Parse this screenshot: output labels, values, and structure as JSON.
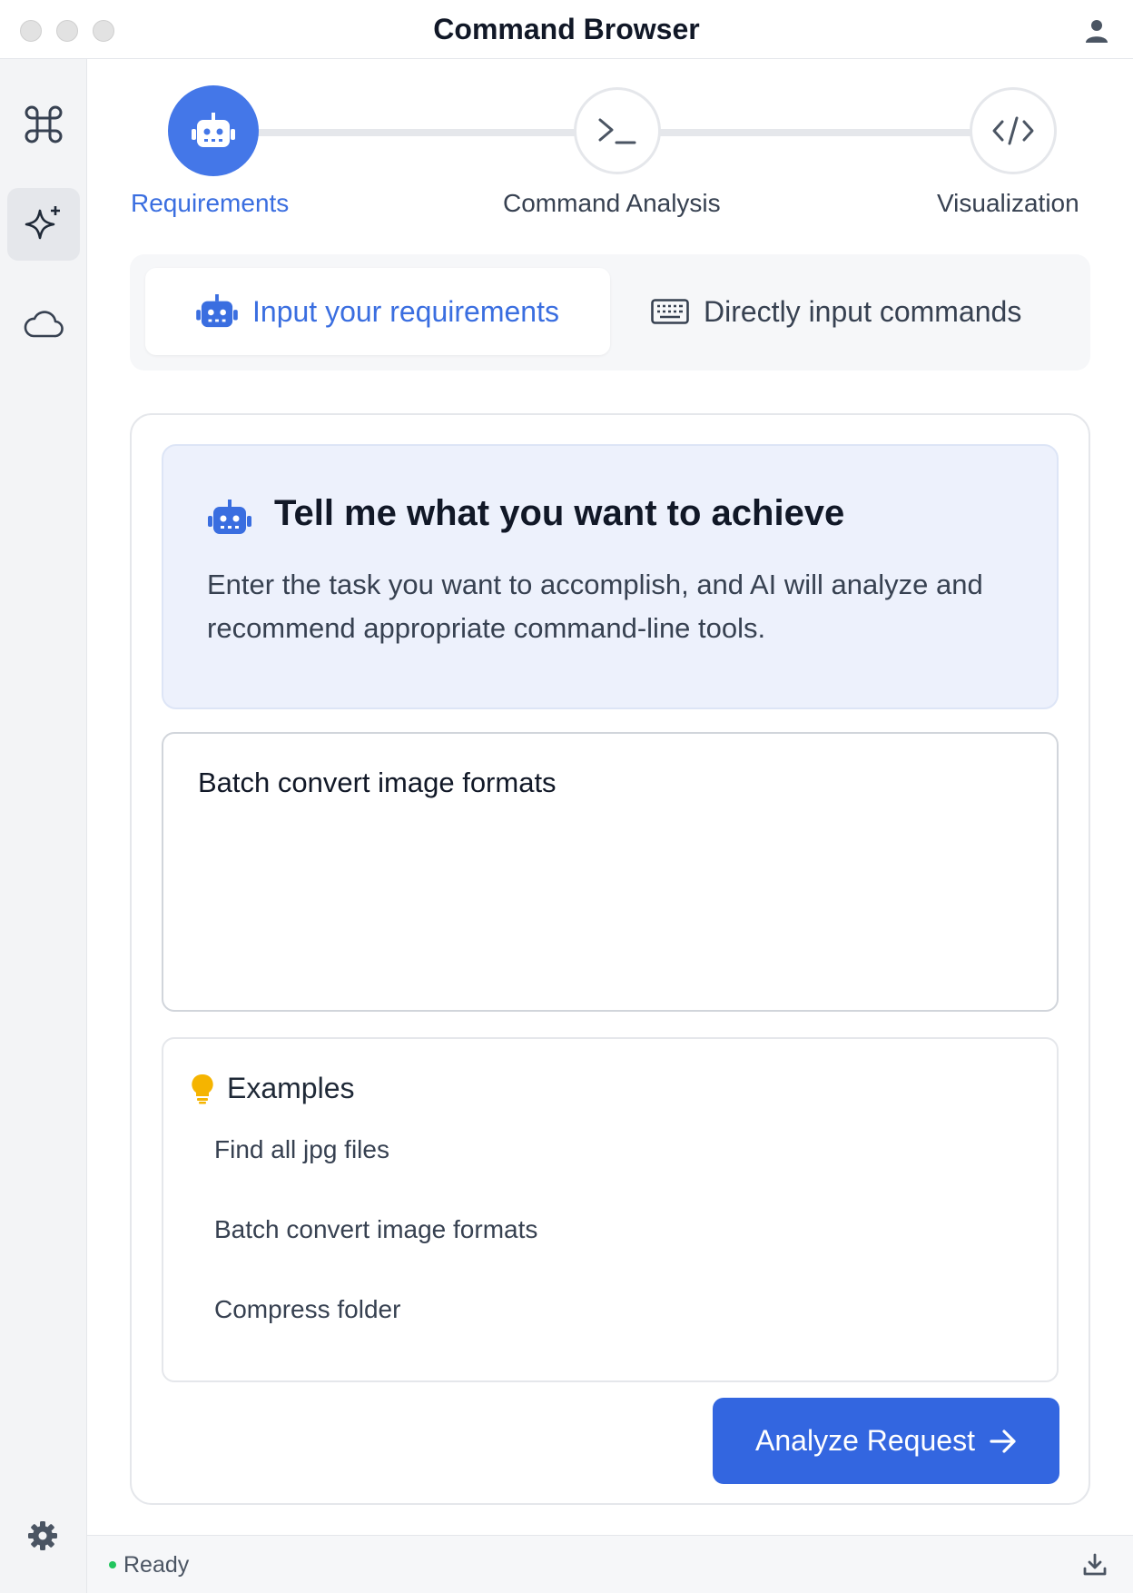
{
  "window": {
    "title": "Command Browser"
  },
  "sidebar": {
    "items": [
      {
        "icon": "command-icon"
      },
      {
        "icon": "sparkles-icon",
        "active": true
      },
      {
        "icon": "cloud-icon"
      }
    ],
    "settings_icon": "gear-icon"
  },
  "stepper": {
    "steps": [
      {
        "label": "Requirements",
        "icon": "robot-icon",
        "active": true
      },
      {
        "label": "Command Analysis",
        "icon": "terminal-icon"
      },
      {
        "label": "Visualization",
        "icon": "code-icon"
      }
    ]
  },
  "tabs": [
    {
      "label": "Input your requirements",
      "icon": "robot-icon",
      "active": true
    },
    {
      "label": "Directly input commands",
      "icon": "keyboard-icon"
    }
  ],
  "hero": {
    "title": "Tell me what you want to achieve",
    "description": "Enter the task you want to accomplish, and AI will analyze and recommend appropriate command-line tools."
  },
  "request_input": {
    "value": "Batch convert image formats"
  },
  "examples": {
    "heading": "Examples",
    "items": [
      "Find all jpg files",
      "Batch convert image formats",
      "Compress folder"
    ]
  },
  "analyze_button": {
    "label": "Analyze Request"
  },
  "status": {
    "text": "Ready"
  },
  "colors": {
    "accent": "#3366e0",
    "status_ok": "#22c55e",
    "bulb": "#f5b400"
  }
}
